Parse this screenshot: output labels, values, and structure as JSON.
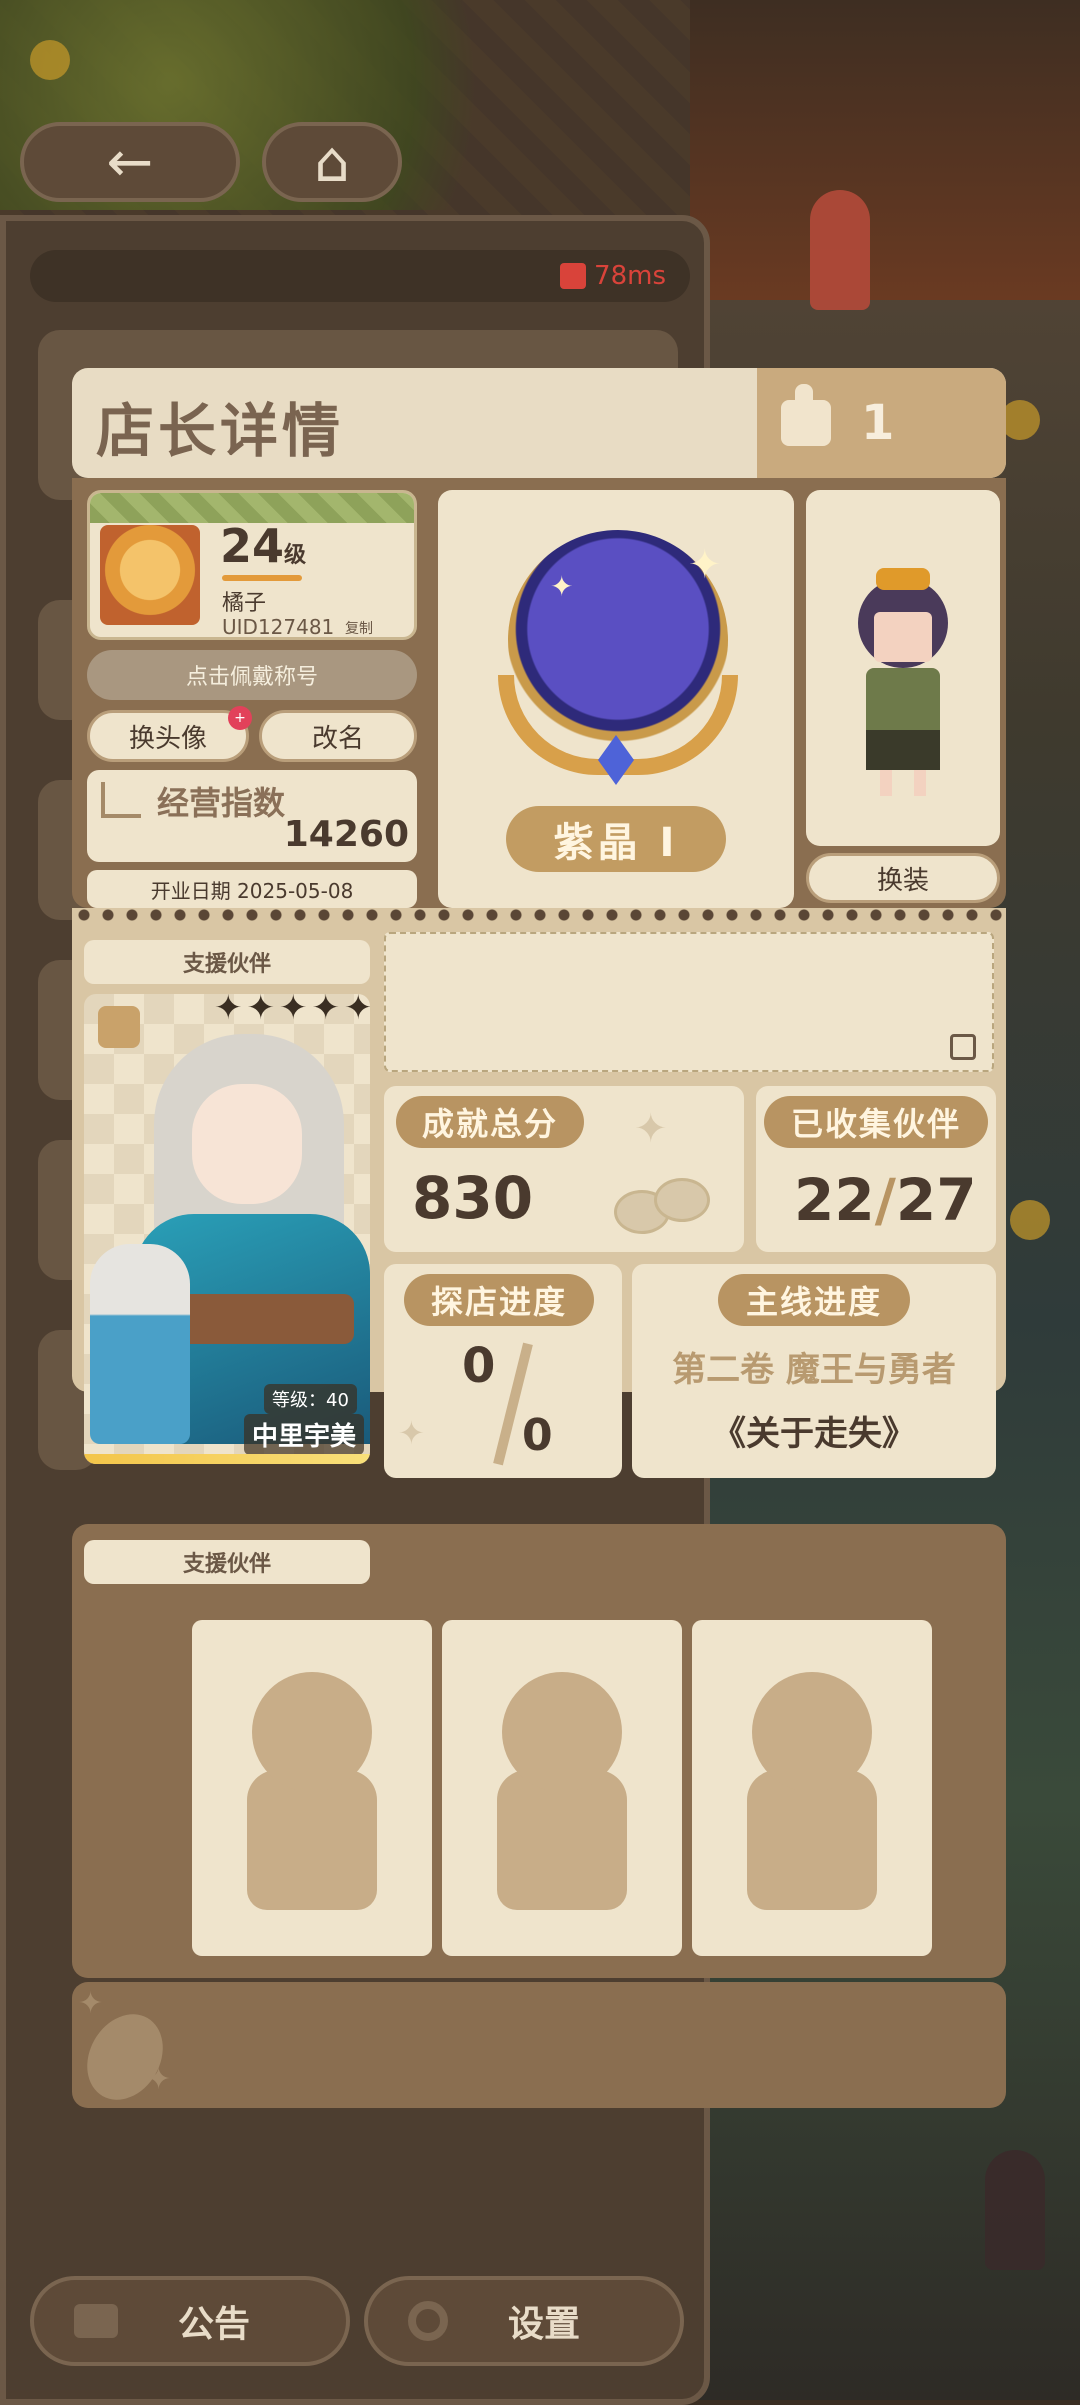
{
  "status": {
    "ping": "78ms"
  },
  "dialog": {
    "title": "店长详情",
    "likes": "1",
    "profile": {
      "level": "24",
      "level_unit": "级",
      "name": "橘子",
      "uid": "UID127481",
      "copy_label": "复制"
    },
    "wear_title_label": "点击佩戴称号",
    "change_avatar_label": "换头像",
    "change_avatar_badge": "+",
    "rename_label": "改名",
    "business_index": {
      "label": "经营指数",
      "value": "14260"
    },
    "open_date": "开业日期 2025-05-08",
    "rank": {
      "name": "紫晶 Ⅰ"
    },
    "outfit_label": "换装",
    "support_partner_label": "支援伙伴",
    "partner": {
      "level": "等级：40",
      "name": "中里宇美",
      "stars": "✦✦✦✦✦"
    },
    "achievement": {
      "label": "成就总分",
      "value": "830"
    },
    "collected": {
      "label": "已收集伙伴",
      "current": "22",
      "sep": "/",
      "total": "27"
    },
    "explore": {
      "label": "探店进度",
      "current": "0",
      "total": "0"
    },
    "story": {
      "label": "主线进度",
      "volume": "第二卷 魔王与勇者",
      "chapter": "《关于走失》"
    },
    "support_partner_label_2": "支援伙伴"
  },
  "bottom": {
    "notice_label": "公告",
    "settings_label": "设置"
  },
  "colors": {
    "accent": "#b89462",
    "panel": "#8a6e50",
    "card": "#efe4cc",
    "rank": "#5a4fc2"
  },
  "icons": [
    "back-arrow-icon",
    "home-icon",
    "signal-icon",
    "thumbs-up-icon",
    "chart-icon",
    "edit-icon",
    "coffee-bean-icon",
    "notice-icon",
    "gear-icon"
  ]
}
